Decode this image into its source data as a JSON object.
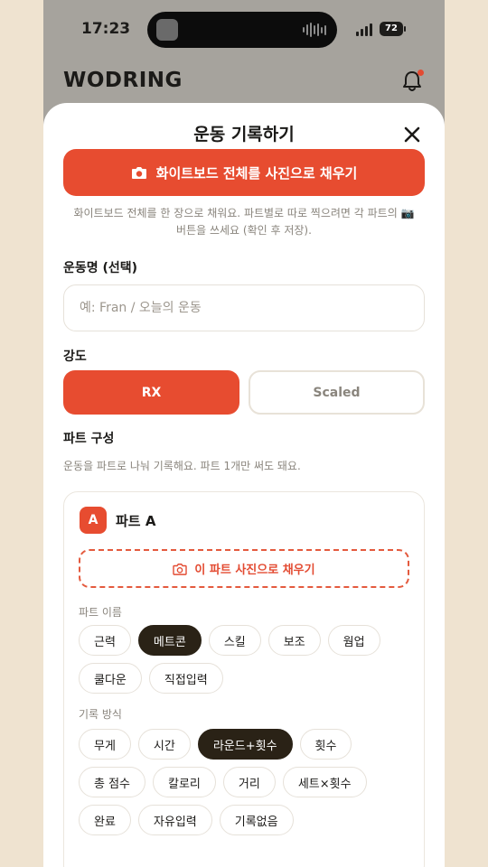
{
  "status": {
    "time": "17:23",
    "battery": "72"
  },
  "app": {
    "logo": "WODRING"
  },
  "sheet": {
    "title": "운동 기록하기",
    "fill_all_label": "화이트보드 전체를 사진으로 채우기",
    "hint_line1": "화이트보드 전체를 한 장으로 채워요. 파트별로 따로 찍으려면 각 파트의 📷",
    "hint_line2": "버튼을 쓰세요 (확인 후 저장).",
    "name_label": "운동명 (선택)",
    "name_placeholder": "예: Fran / 오늘의 운동",
    "name_value": "",
    "intensity_label": "강도",
    "intensity_options": [
      "RX",
      "Scaled"
    ],
    "intensity_selected": "RX",
    "parts_label": "파트 구성",
    "parts_hint": "운동을 파트로 나눠 기록해요. 파트 1개만 써도 돼요."
  },
  "part": {
    "badge": "A",
    "title": "파트 A",
    "fill_part_label": "이 파트 사진으로 채우기",
    "name_section": "파트 이름",
    "names": [
      "근력",
      "메트콘",
      "스킬",
      "보조",
      "웜업",
      "쿨다운",
      "직접입력"
    ],
    "name_selected": "메트콘",
    "method_section": "기록 방식",
    "methods": [
      "무게",
      "시간",
      "라운드+횟수",
      "횟수",
      "총 점수",
      "칼로리",
      "거리",
      "세트×횟수",
      "완료",
      "자유입력",
      "기록없음"
    ],
    "method_selected": "라운드+횟수"
  },
  "colors": {
    "accent": "#e74c30",
    "chip_active": "#2a2216",
    "background": "#efe3d0"
  },
  "icons": {
    "camera": "camera-icon",
    "close": "close-icon",
    "bell": "bell-icon"
  }
}
